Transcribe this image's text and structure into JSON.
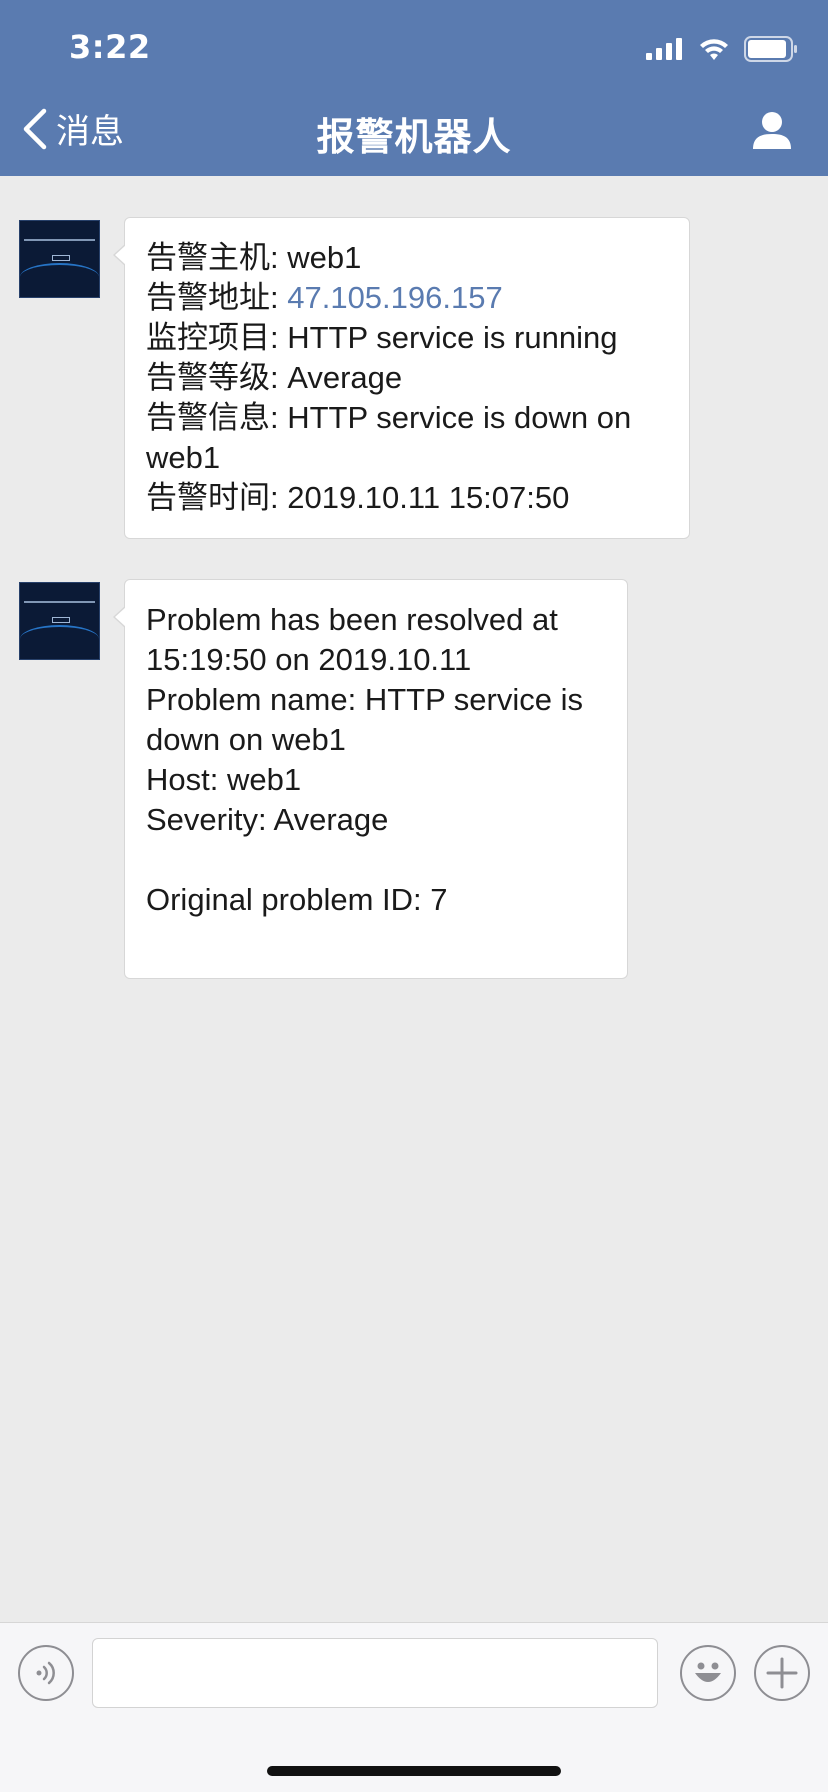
{
  "status_bar": {
    "time": "3:22"
  },
  "nav": {
    "back_label": "消息",
    "title": "报警机器人"
  },
  "messages": [
    {
      "lines": [
        {
          "label": "告警主机: ",
          "value": "web1"
        },
        {
          "label": "告警地址: ",
          "value": "47.105.196.157"
        },
        {
          "label": "监控项目: ",
          "value": "HTTP service is running"
        },
        {
          "label": "告警等级: ",
          "value": "Average"
        },
        {
          "label": "告警信息: ",
          "value": "HTTP service is down on web1"
        },
        {
          "label": "告警时间: ",
          "value": "2019.10.11 15:07:50"
        }
      ]
    },
    {
      "lines": [
        "Problem has been resolved at 15:19:50 on 2019.10.11",
        "Problem name: HTTP service is down on web1",
        "Host: web1",
        "Severity: Average",
        "",
        "Original problem ID: 7",
        ""
      ]
    }
  ],
  "input_bar": {
    "voice_icon": "voice-icon",
    "emoji_icon": "emoji-icon",
    "add_icon": "plus-icon",
    "text_value": ""
  },
  "colors": {
    "header_bg": "#5a7bb0",
    "link": "#5a7bb0",
    "chat_bg": "#ebebeb"
  }
}
